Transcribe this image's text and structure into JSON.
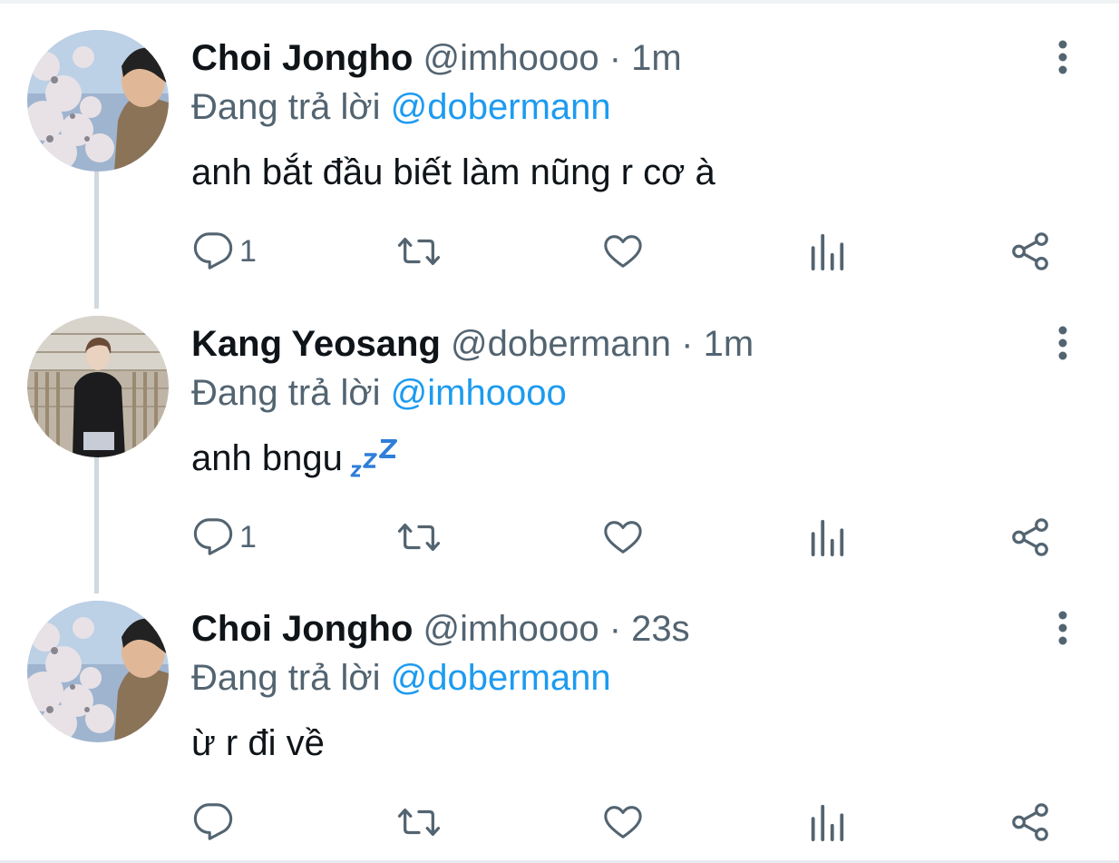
{
  "colors": {
    "name": "#0f1419",
    "secondary": "#536471",
    "accent": "#1d9bf0",
    "thread_line": "#cfd9de"
  },
  "tweets": [
    {
      "display_name": "Choi Jongho",
      "handle": "@imhoooo",
      "separator": "·",
      "time": "1m",
      "reply_prefix": "Đang trả lời",
      "reply_to": "@dobermann",
      "text": "anh bắt đầu biết làm nũng r cơ à",
      "reply_count": "1",
      "avatar": "cherry-blossom-profile-photo"
    },
    {
      "display_name": "Kang Yeosang",
      "handle": "@dobermann",
      "separator": "·",
      "time": "1m",
      "reply_prefix": "Đang trả lời",
      "reply_to": "@imhoooo",
      "text": "anh bngu",
      "emoji": "zzz",
      "reply_count": "1",
      "avatar": "standing-person-photo"
    },
    {
      "display_name": "Choi Jongho",
      "handle": "@imhoooo",
      "separator": "·",
      "time": "23s",
      "reply_prefix": "Đang trả lời",
      "reply_to": "@dobermann",
      "text": "ừ r đi về",
      "reply_count": "",
      "avatar": "cherry-blossom-profile-photo"
    }
  ],
  "action_icons": [
    "reply-icon",
    "retweet-icon",
    "like-icon",
    "views-icon",
    "share-icon"
  ]
}
